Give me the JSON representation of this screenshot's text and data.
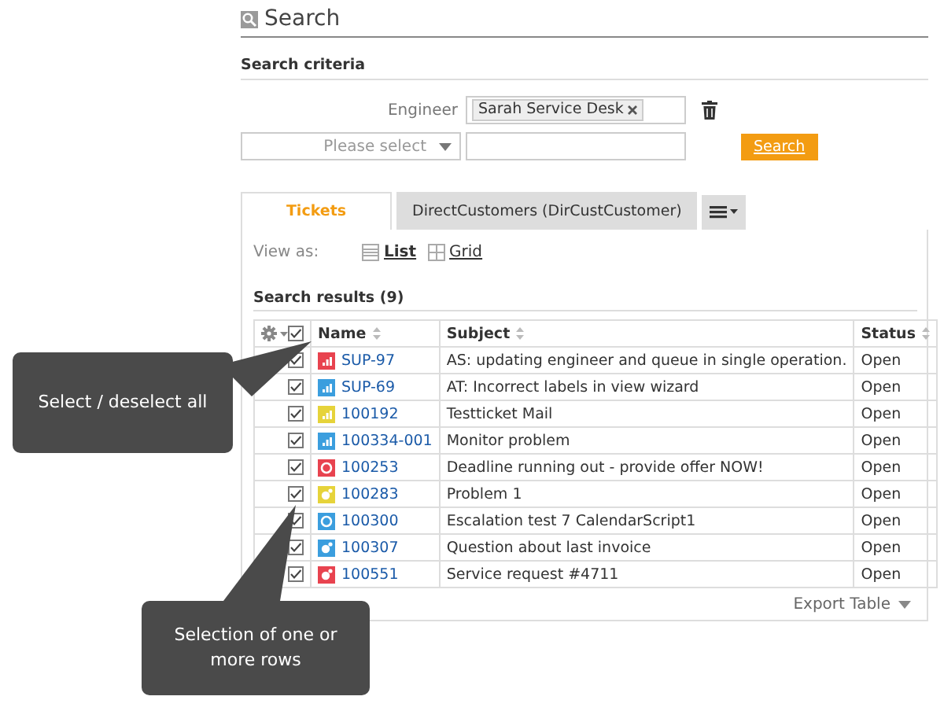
{
  "page": {
    "title": "Search"
  },
  "criteria": {
    "heading": "Search criteria",
    "engineer_label": "Engineer",
    "engineer_tag": "Sarah Service Desk",
    "select_placeholder": "Please select",
    "search_button": "Search"
  },
  "tabs": [
    {
      "label": "Tickets",
      "selected": true
    },
    {
      "label": "DirectCustomers (DirCustCustomer)",
      "selected": false
    }
  ],
  "view": {
    "label": "View as:",
    "options": [
      {
        "label": "List",
        "selected": true,
        "kind": "list"
      },
      {
        "label": "Grid",
        "selected": false,
        "kind": "grid"
      }
    ]
  },
  "results": {
    "heading": "Search results (9)",
    "all_checked": true,
    "columns": [
      "Name",
      "Subject",
      "Status"
    ],
    "rows": [
      {
        "name": "SUP-97",
        "subject": "AS: updating engineer and queue in single operation.",
        "status": "Open",
        "checked": true,
        "color": "#e8434f",
        "kind": "chart"
      },
      {
        "name": "SUP-69",
        "subject": "AT: Incorrect labels in view wizard",
        "status": "Open",
        "checked": true,
        "color": "#3b9ede",
        "kind": "chart"
      },
      {
        "name": "100192",
        "subject": "Testticket Mail",
        "status": "Open",
        "checked": true,
        "color": "#e6d33a",
        "kind": "chart"
      },
      {
        "name": "100334-001",
        "subject": "Monitor problem",
        "status": "Open",
        "checked": true,
        "color": "#3b9ede",
        "kind": "chart"
      },
      {
        "name": "100253",
        "subject": "Deadline running out - provide offer NOW!",
        "status": "Open",
        "checked": true,
        "color": "#e8434f",
        "kind": "ring"
      },
      {
        "name": "100283",
        "subject": "Problem 1",
        "status": "Open",
        "checked": true,
        "color": "#e6d33a",
        "kind": "bubble"
      },
      {
        "name": "100300",
        "subject": "Escalation test 7 CalendarScript1",
        "status": "Open",
        "checked": true,
        "color": "#3b9ede",
        "kind": "ring"
      },
      {
        "name": "100307",
        "subject": "Question about last invoice",
        "status": "Open",
        "checked": true,
        "color": "#3b9ede",
        "kind": "bubble"
      },
      {
        "name": "100551",
        "subject": "Service request #4711",
        "status": "Open",
        "checked": true,
        "color": "#e8434f",
        "kind": "bubble"
      }
    ],
    "export": "Export Table"
  },
  "callouts": [
    {
      "text": "Select / deselect all"
    },
    {
      "text": "Selection of one or more rows"
    }
  ]
}
